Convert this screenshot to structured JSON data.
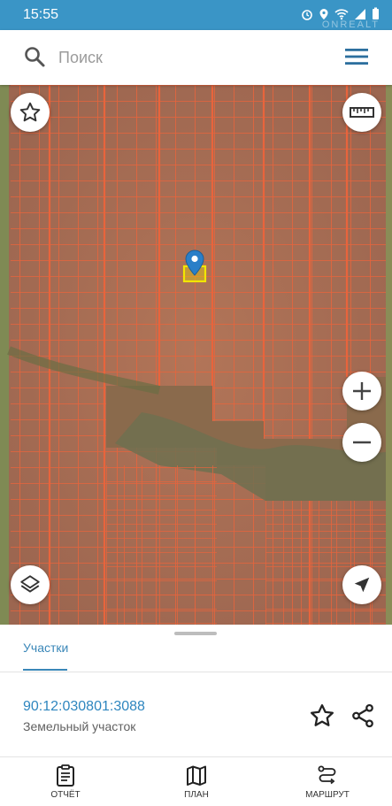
{
  "status_bar": {
    "time": "15:55",
    "watermark": "ONREALT"
  },
  "search": {
    "placeholder": "Поиск"
  },
  "panel": {
    "tab_label": "Участки",
    "parcel_id": "90:12:030801:3088",
    "parcel_type": "Земельный участок"
  },
  "bottom_nav": [
    {
      "label": "ОТЧЁТ",
      "icon": "report-icon"
    },
    {
      "label": "ПЛАН",
      "icon": "map-plan-icon"
    },
    {
      "label": "МАРШРУТ",
      "icon": "route-icon"
    }
  ],
  "colors": {
    "accent": "#3a95c6",
    "link": "#2e86bf",
    "parcel_lines": "#e8643c",
    "highlight": "#f2e600",
    "pin": "#2a7fc8"
  }
}
